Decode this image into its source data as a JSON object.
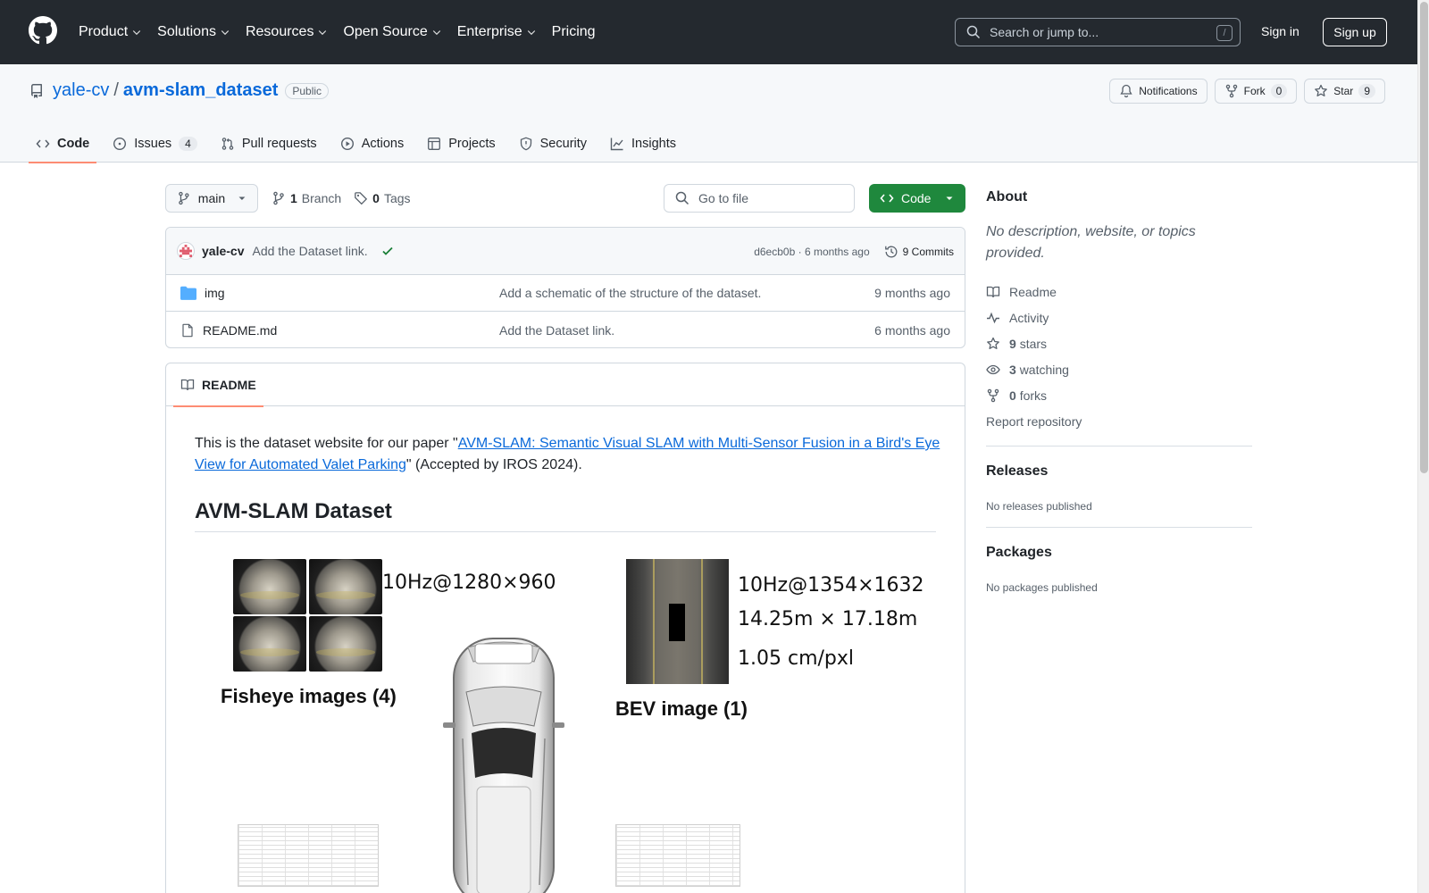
{
  "header": {
    "nav": [
      "Product",
      "Solutions",
      "Resources",
      "Open Source",
      "Enterprise",
      "Pricing"
    ],
    "search_placeholder": "Search or jump to...",
    "search_shortcut": "/",
    "signin": "Sign in",
    "signup": "Sign up"
  },
  "repo": {
    "owner": "yale-cv",
    "separator": "/",
    "name": "avm-slam_dataset",
    "visibility": "Public",
    "notifications_label": "Notifications",
    "fork_label": "Fork",
    "fork_count": "0",
    "star_label": "Star",
    "star_count": "9",
    "tabs": [
      {
        "label": "Code",
        "icon": "code-icon",
        "selected": true
      },
      {
        "label": "Issues",
        "icon": "issue-opened-icon",
        "count": "4"
      },
      {
        "label": "Pull requests",
        "icon": "git-pull-request-icon"
      },
      {
        "label": "Actions",
        "icon": "play-icon"
      },
      {
        "label": "Projects",
        "icon": "table-icon"
      },
      {
        "label": "Security",
        "icon": "shield-icon"
      },
      {
        "label": "Insights",
        "icon": "graph-icon"
      }
    ]
  },
  "toolbar": {
    "branch": "main",
    "branch_count": "1",
    "branch_label": "Branch",
    "tag_count": "0",
    "tag_label": "Tags",
    "goto_file_placeholder": "Go to file",
    "code_button": "Code"
  },
  "commit": {
    "author": "yale-cv",
    "message": "Add the Dataset link.",
    "hash": "d6ecb0b",
    "separator": "·",
    "age": "6 months ago",
    "commits_label": "9 Commits"
  },
  "files": [
    {
      "name": "img",
      "type": "folder",
      "commit": "Add a schematic of the structure of the dataset.",
      "age": "9 months ago"
    },
    {
      "name": "README.md",
      "type": "file",
      "commit": "Add the Dataset link.",
      "age": "6 months ago"
    }
  ],
  "readme": {
    "tab_label": "README",
    "intro_prefix": "This is the dataset website for our paper \"",
    "intro_link": "AVM-SLAM: Semantic Visual SLAM with Multi-Sensor Fusion in a Bird's Eye View for Automated Valet Parking",
    "intro_suffix": "\" (Accepted by IROS 2024).",
    "heading": "AVM-SLAM Dataset",
    "figure": {
      "fisheye_spec": "10Hz@1280×960",
      "fisheye_caption": "Fisheye images (4)",
      "bev_spec": "10Hz@1354×1632",
      "bev_size": "14.25m × 17.18m",
      "bev_resolution": "1.05 cm/pxl",
      "bev_caption": "BEV image (1)"
    }
  },
  "sidebar": {
    "about_title": "About",
    "about_desc": "No description, website, or topics provided.",
    "readme_label": "Readme",
    "activity_label": "Activity",
    "stars_count": "9",
    "stars_label": "stars",
    "watching_count": "3",
    "watching_label": "watching",
    "forks_count": "0",
    "forks_label": "forks",
    "report": "Report repository",
    "releases_title": "Releases",
    "releases_empty": "No releases published",
    "packages_title": "Packages",
    "packages_empty": "No packages published"
  },
  "colors": {
    "header_bg": "#24292f",
    "link": "#0969da",
    "code_button": "#1f883d",
    "tab_underline": "#fd8c73",
    "success": "#1a7f37"
  }
}
